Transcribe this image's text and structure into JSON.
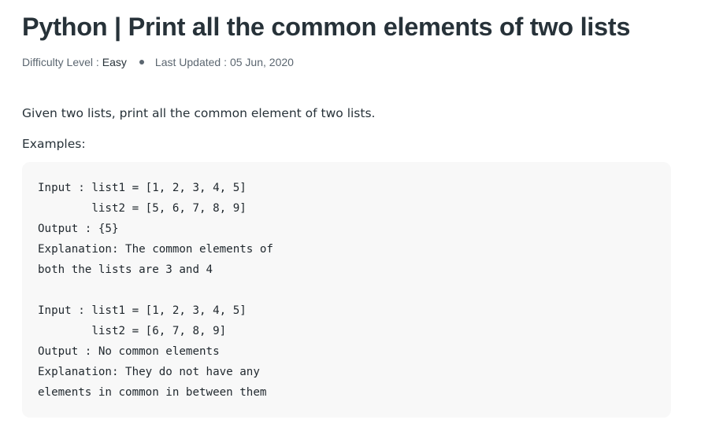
{
  "article": {
    "title": "Python | Print all the common elements of two lists",
    "meta": {
      "difficulty_label": "Difficulty Level :",
      "difficulty_value": "Easy",
      "updated_label": "Last Updated :",
      "updated_value": "05 Jun, 2020"
    },
    "intro": "Given two lists, print all the common element of two lists.",
    "examples_label": "Examples:",
    "code": "Input : list1 = [1, 2, 3, 4, 5]\n        list2 = [5, 6, 7, 8, 9]\nOutput : {5}\nExplanation: The common elements of \nboth the lists are 3 and 4 \n\nInput : list1 = [1, 2, 3, 4, 5]\n        list2 = [6, 7, 8, 9]\nOutput : No common elements \nExplanation: They do not have any \nelements in common in between them"
  },
  "colors": {
    "text": "#273239",
    "muted": "#5b6670",
    "code_background": "#f8f8f8"
  }
}
